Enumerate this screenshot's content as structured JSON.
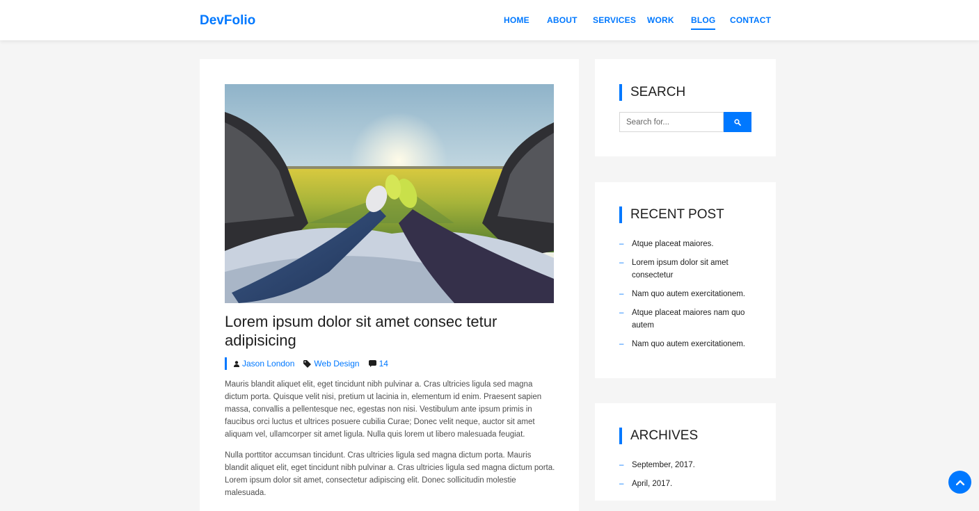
{
  "brand": "DevFolio",
  "nav": {
    "items": [
      {
        "label": "HOME"
      },
      {
        "label": "ABOUT"
      },
      {
        "label": "SERVICES"
      },
      {
        "label": "WORK"
      },
      {
        "label": "BLOG",
        "active": true
      },
      {
        "label": "CONTACT"
      }
    ]
  },
  "colors": {
    "accent": "#0078ff",
    "background": "#f5f5f5",
    "text": "#1e1e1e"
  },
  "post": {
    "image_alt": "Two people lying in the back of a car looking at a sunset over a field",
    "title": "Lorem ipsum dolor sit amet consec tetur adipisicing",
    "author": "Jason London",
    "category": "Web Design",
    "comments": "14",
    "paragraphs": [
      "Mauris blandit aliquet elit, eget tincidunt nibh pulvinar a. Cras ultricies ligula sed magna dictum porta. Quisque velit nisi, pretium ut lacinia in, elementum id enim. Praesent sapien massa, convallis a pellentesque nec, egestas non nisi. Vestibulum ante ipsum primis in faucibus orci luctus et ultrices posuere cubilia Curae; Donec velit neque, auctor sit amet aliquam vel, ullamcorper sit amet ligula. Nulla quis lorem ut libero malesuada feugiat.",
      "Nulla porttitor accumsan tincidunt. Cras ultricies ligula sed magna dictum porta. Mauris blandit aliquet elit, eget tincidunt nibh pulvinar a. Cras ultricies ligula sed magna dictum porta. Lorem ipsum dolor sit amet, consectetur adipiscing elit. Donec sollicitudin molestie malesuada."
    ]
  },
  "sidebar": {
    "search": {
      "title": "SEARCH",
      "placeholder": "Search for...",
      "icon": "search-icon"
    },
    "recent": {
      "title": "RECENT POST",
      "items": [
        "Atque placeat maiores.",
        "Lorem ipsum dolor sit amet consectetur",
        "Nam quo autem exercitationem.",
        "Atque placeat maiores nam quo autem",
        "Nam quo autem exercitationem."
      ]
    },
    "archives": {
      "title": "ARCHIVES",
      "items": [
        "September, 2017.",
        "April, 2017."
      ]
    }
  },
  "back_to_top_icon": "chevron-up-icon"
}
